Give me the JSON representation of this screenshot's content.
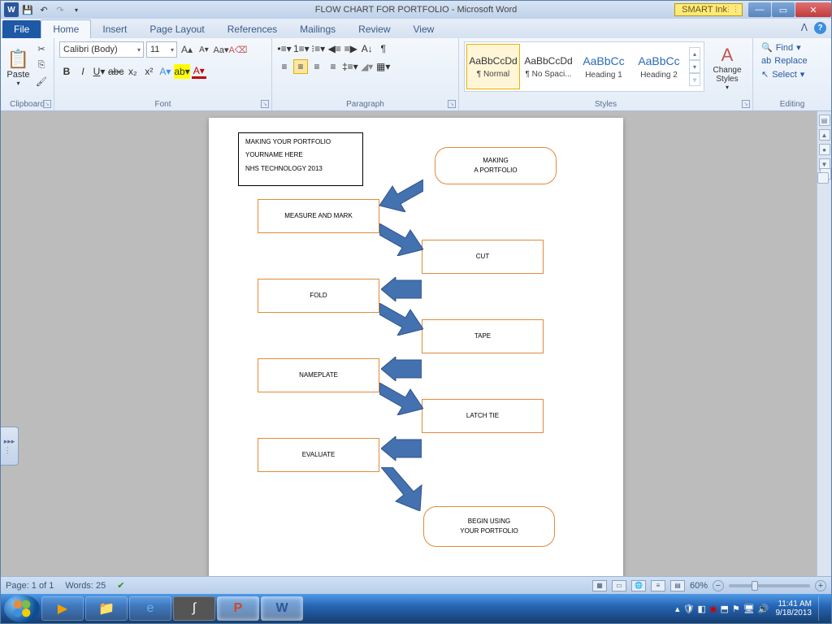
{
  "titlebar": {
    "title": "FLOW CHART FOR PORTFOLIO - Microsoft Word",
    "smart_ink": "SMART Ink"
  },
  "tabs": {
    "file": "File",
    "home": "Home",
    "insert": "Insert",
    "page_layout": "Page Layout",
    "references": "References",
    "mailings": "Mailings",
    "review": "Review",
    "view": "View"
  },
  "ribbon": {
    "clipboard": {
      "label": "Clipboard",
      "paste": "Paste"
    },
    "font": {
      "label": "Font",
      "name": "Calibri (Body)",
      "size": "11"
    },
    "paragraph": {
      "label": "Paragraph"
    },
    "styles": {
      "label": "Styles",
      "items": [
        {
          "preview": "AaBbCcDd",
          "name": "¶ Normal"
        },
        {
          "preview": "AaBbCcDd",
          "name": "¶ No Spaci..."
        },
        {
          "preview": "AaBbCc",
          "name": "Heading 1"
        },
        {
          "preview": "AaBbCc",
          "name": "Heading 2"
        }
      ],
      "change": "Change Styles"
    },
    "editing": {
      "label": "Editing",
      "find": "Find",
      "replace": "Replace",
      "select": "Select"
    }
  },
  "document": {
    "title_box": {
      "l1": "MAKING YOUR PORTFOLIO",
      "l2": "YOURNAME HERE",
      "l3": "NHS TECHNOLOGY 2013"
    },
    "start": {
      "l1": "MAKING",
      "l2": "A PORTFOLIO"
    },
    "steps": {
      "measure": "MEASURE AND MARK",
      "cut": "CUT",
      "fold": "FOLD",
      "tape": "TAPE",
      "nameplate": "NAMEPLATE",
      "latch": "LATCH TIE",
      "evaluate": "EVALUATE"
    },
    "end": {
      "l1": "BEGIN USING",
      "l2": "YOUR PORTFOLIO"
    }
  },
  "status": {
    "page": "Page: 1 of 1",
    "words": "Words: 25",
    "zoom": "60%"
  },
  "taskbar": {
    "time": "11:41 AM",
    "date": "9/18/2013"
  }
}
